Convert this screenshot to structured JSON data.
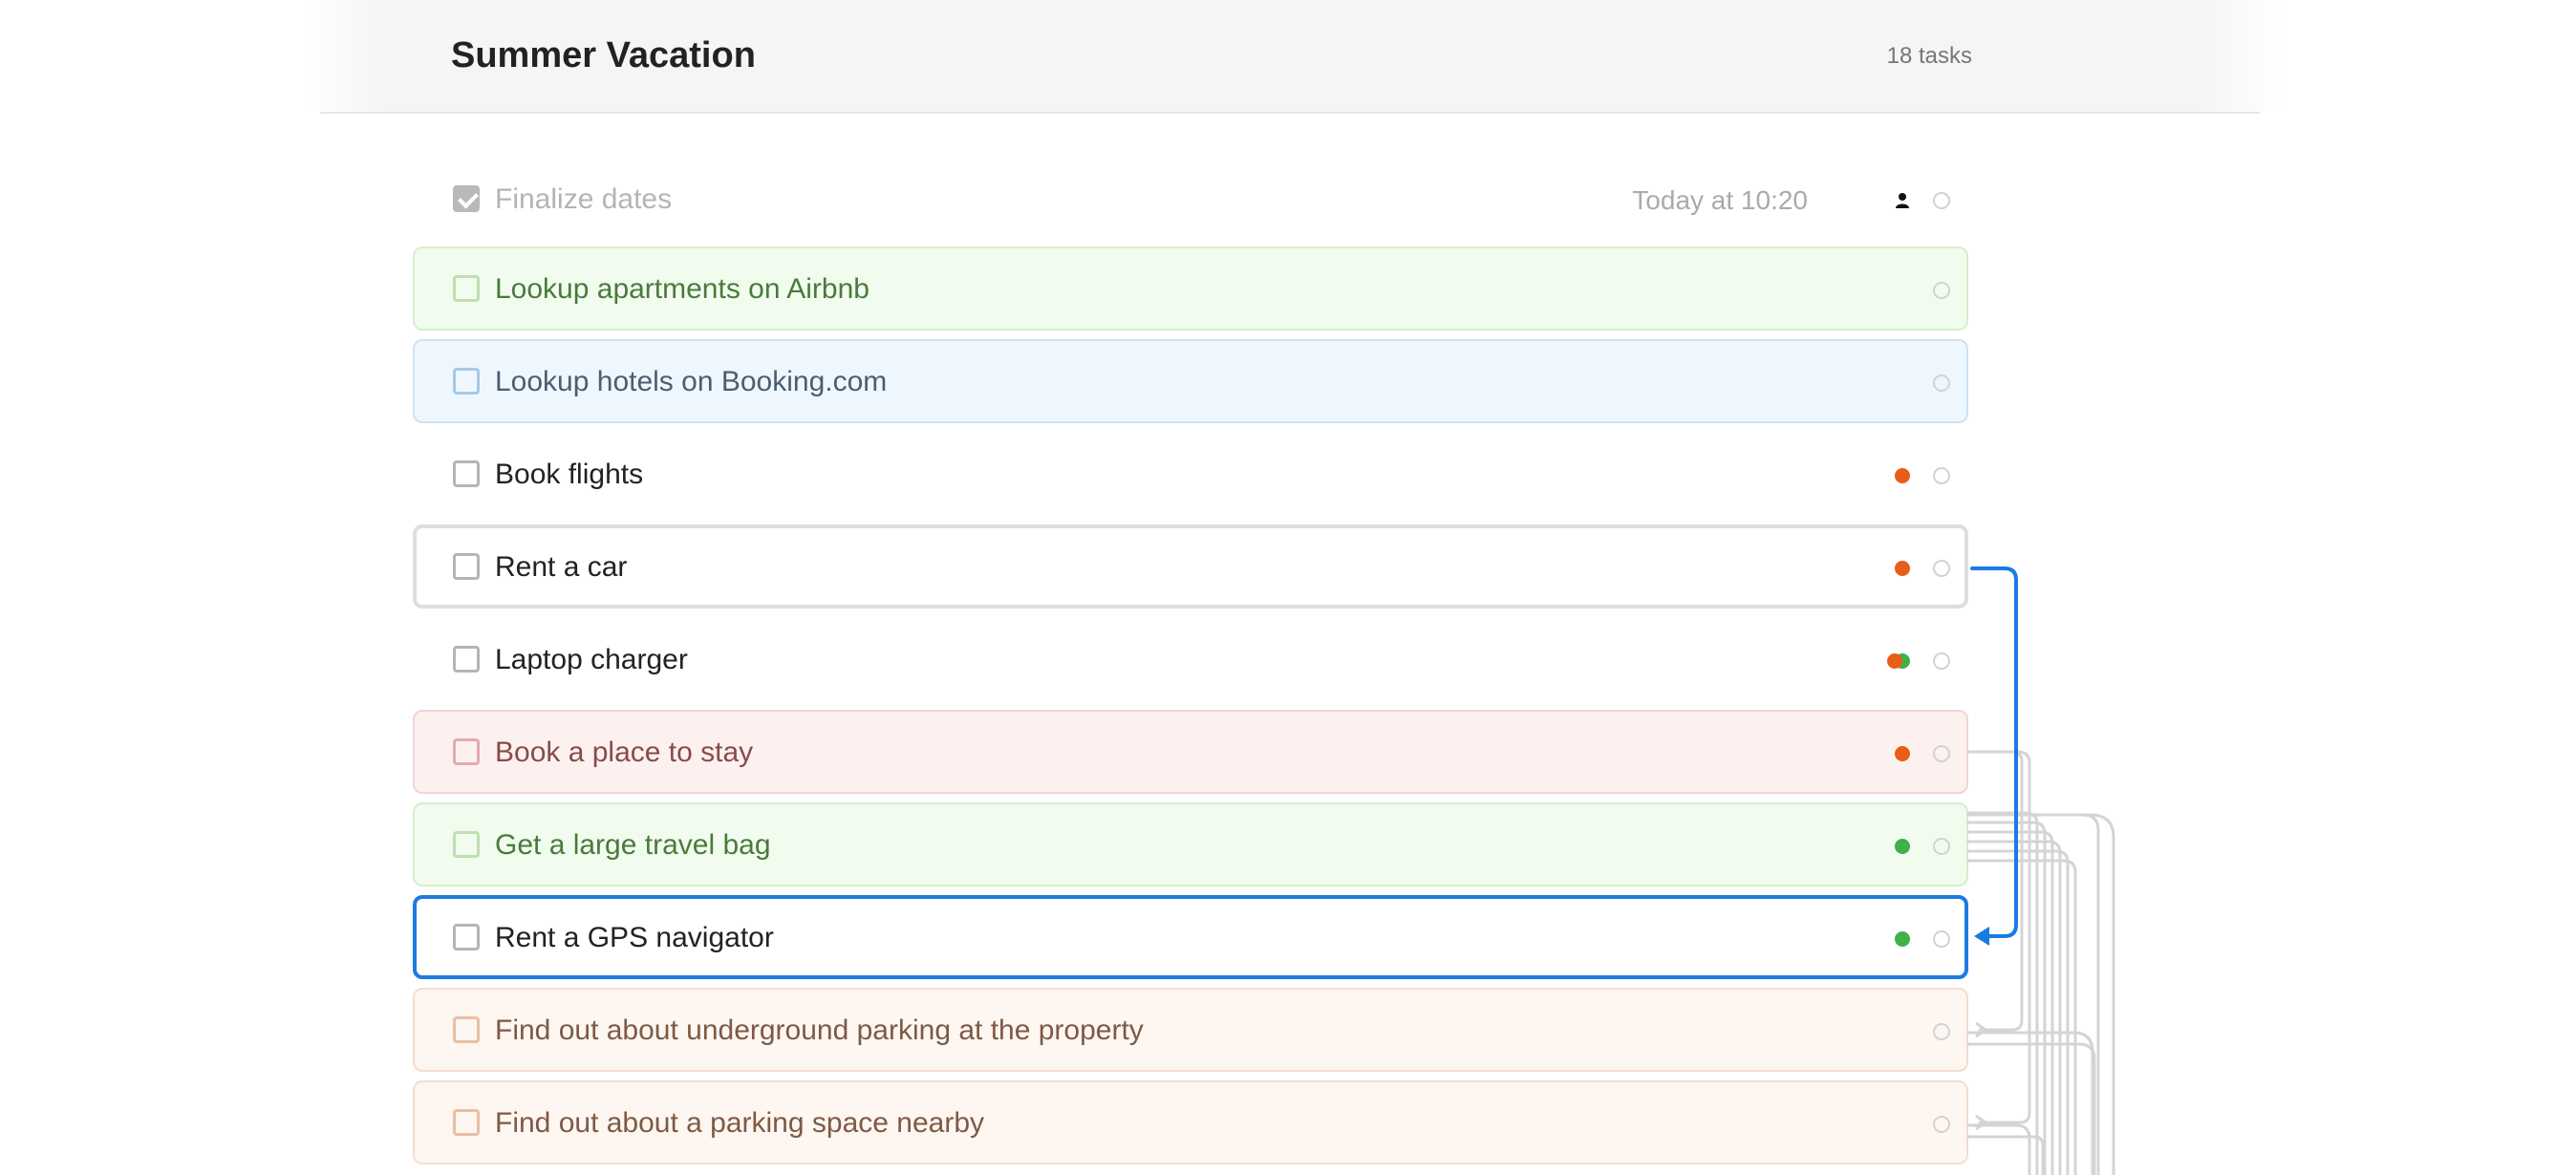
{
  "header": {
    "title": "Summer Vacation",
    "task_count": "18 tasks"
  },
  "tasks": [
    {
      "label": "Finalize dates",
      "done": true,
      "due": "Today at 10:20"
    },
    {
      "label": "Lookup apartments on Airbnb",
      "color": "green"
    },
    {
      "label": "Lookup hotels on Booking.com",
      "color": "blue"
    },
    {
      "label": "Book flights",
      "tags": [
        "orange"
      ]
    },
    {
      "label": "Rent a car",
      "tags": [
        "orange"
      ],
      "state": "selected"
    },
    {
      "label": "Laptop charger",
      "tags": [
        "orange",
        "green"
      ]
    },
    {
      "label": "Book a place to stay",
      "color": "red",
      "tags": [
        "orange"
      ]
    },
    {
      "label": "Get a large travel bag",
      "color": "green",
      "tags": [
        "green"
      ]
    },
    {
      "label": "Rent a GPS navigator",
      "tags": [
        "green"
      ],
      "state": "focused"
    },
    {
      "label": "Find out about underground parking at the property",
      "color": "orange"
    },
    {
      "label": "Find out about a parking space nearby",
      "color": "orange"
    }
  ],
  "colors": {
    "tag_orange": "#e85d17",
    "tag_green": "#3eb14b",
    "dependency_active": "#1a7be3",
    "dependency_inactive": "#d4d4d4"
  }
}
